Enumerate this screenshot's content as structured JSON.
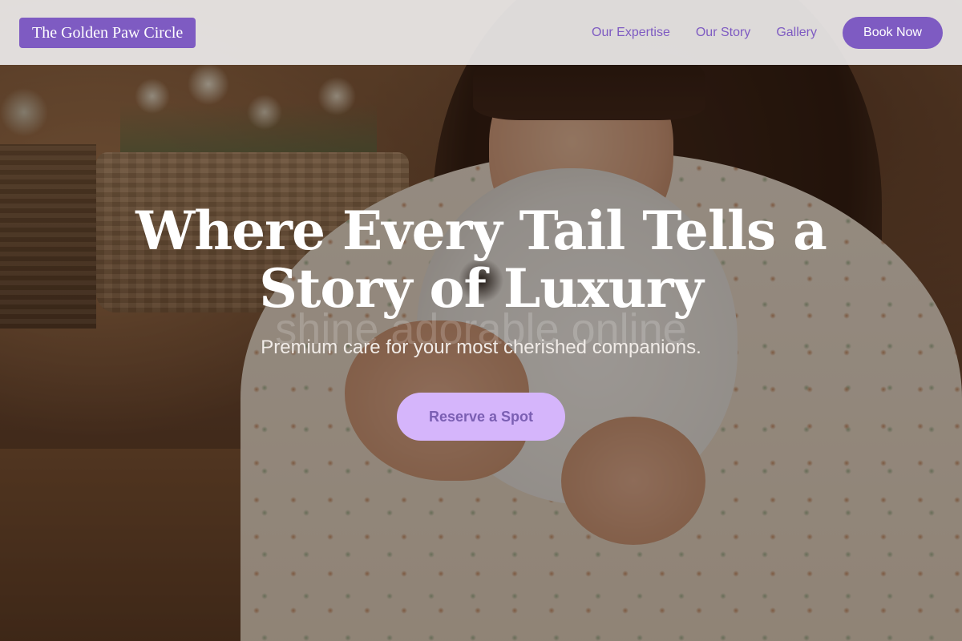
{
  "header": {
    "brand": "The Golden Paw Circle",
    "nav": {
      "expertise": "Our Expertise",
      "story": "Our Story",
      "gallery": "Gallery",
      "book": "Book Now"
    }
  },
  "hero": {
    "headline": "Where Every Tail Tells a Story of Luxury",
    "ghost_text": "shine adorable online",
    "subtitle": "Premium care for your most cherished companions.",
    "cta": "Reserve a Spot",
    "image_description": "woman holding white rabbit"
  },
  "colors": {
    "brand_purple": "#7e5bc2",
    "cta_lavender": "#d5b5fb",
    "header_bg": "#ecebeb"
  }
}
